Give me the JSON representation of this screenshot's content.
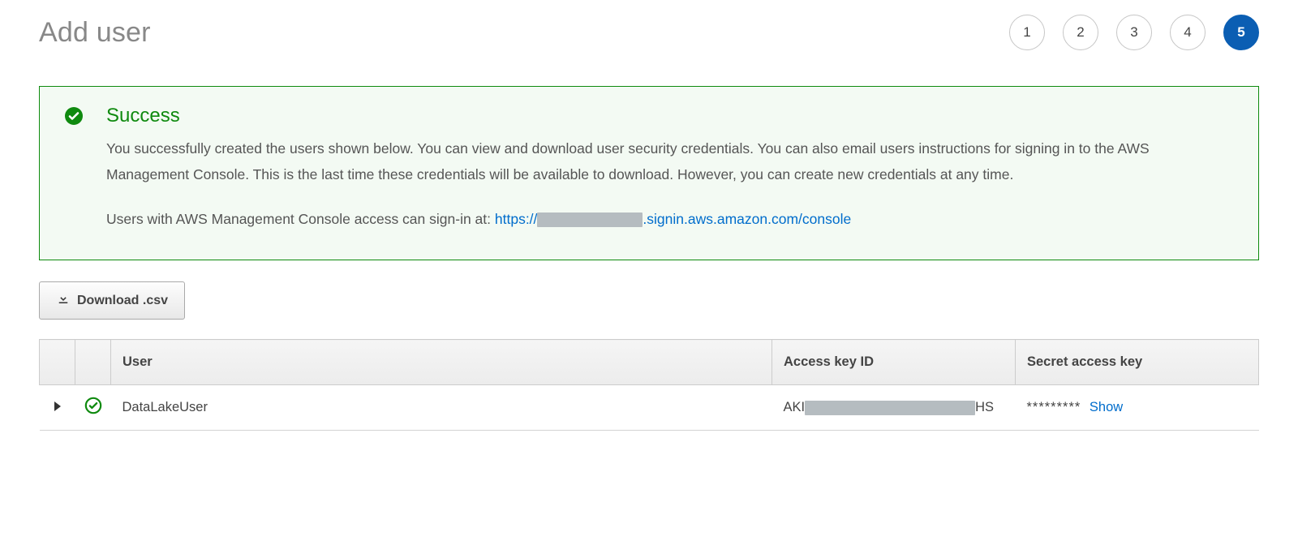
{
  "page": {
    "title": "Add user"
  },
  "stepper": {
    "steps": [
      {
        "n": "1",
        "active": false
      },
      {
        "n": "2",
        "active": false
      },
      {
        "n": "3",
        "active": false
      },
      {
        "n": "4",
        "active": false
      },
      {
        "n": "5",
        "active": true
      }
    ]
  },
  "alert": {
    "title": "Success",
    "body": "You successfully created the users shown below. You can view and download user security credentials. You can also email users instructions for signing in to the AWS Management Console. This is the last time these credentials will be available to download. However, you can create new credentials at any time.",
    "signin_prefix": "Users with AWS Management Console access can sign-in at: ",
    "signin_url_prefix": "https://",
    "signin_url_suffix": ".signin.aws.amazon.com/console"
  },
  "actions": {
    "download_csv": "Download .csv"
  },
  "table": {
    "columns": {
      "user": "User",
      "access_key_id": "Access key ID",
      "secret_access_key": "Secret access key"
    },
    "rows": [
      {
        "user": "DataLakeUser",
        "access_key_prefix": "AKI",
        "access_key_suffix": "HS",
        "secret_masked": "*********",
        "show_label": "Show"
      }
    ]
  }
}
